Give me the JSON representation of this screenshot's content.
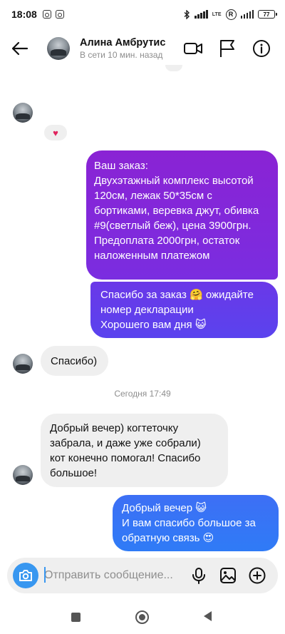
{
  "status_bar": {
    "time": "18:08",
    "network_label": "LTE",
    "battery": "77"
  },
  "header": {
    "name": "Алина Амбрутис",
    "status": "В сети 10 мин. назад"
  },
  "messages": {
    "reaction": "♥",
    "out1": "Ваш заказ:\nДвухэтажный комплекс высотой 120см, лежак 50*35см с бортиками, веревка джут, обивка #9(светлый беж), цена 3900грн.\nПредоплата 2000грн, остаток наложенным платежом",
    "out2": "Спасибо за заказ 🤗 ожидайте номер декларации\nХорошего вам дня 😺",
    "in1": "Спасибо)",
    "divider": "Сегодня 17:49",
    "in2": "Добрый вечер) когтеточку забрала, и даже уже собрали) кот конечно помогал! Спасибо большое!",
    "out3": "Добрый вечер 😺\nИ вам спасибо большое за обратную связь 😍"
  },
  "composer": {
    "placeholder": "Отправить сообщение..."
  },
  "icons": {
    "back": "arrow-left-icon",
    "video": "video-camera-icon",
    "flag": "flag-icon",
    "info": "info-icon",
    "camera": "camera-icon",
    "mic": "microphone-icon",
    "gallery": "gallery-icon",
    "add": "plus-circle-icon"
  },
  "colors": {
    "out_gradient_top": "#8a23d4",
    "out_gradient_mid": "#5a43ee",
    "out_gradient_bottom": "#2f7bf6",
    "incoming_bg": "#efefef",
    "camera_button": "#3897f0"
  }
}
